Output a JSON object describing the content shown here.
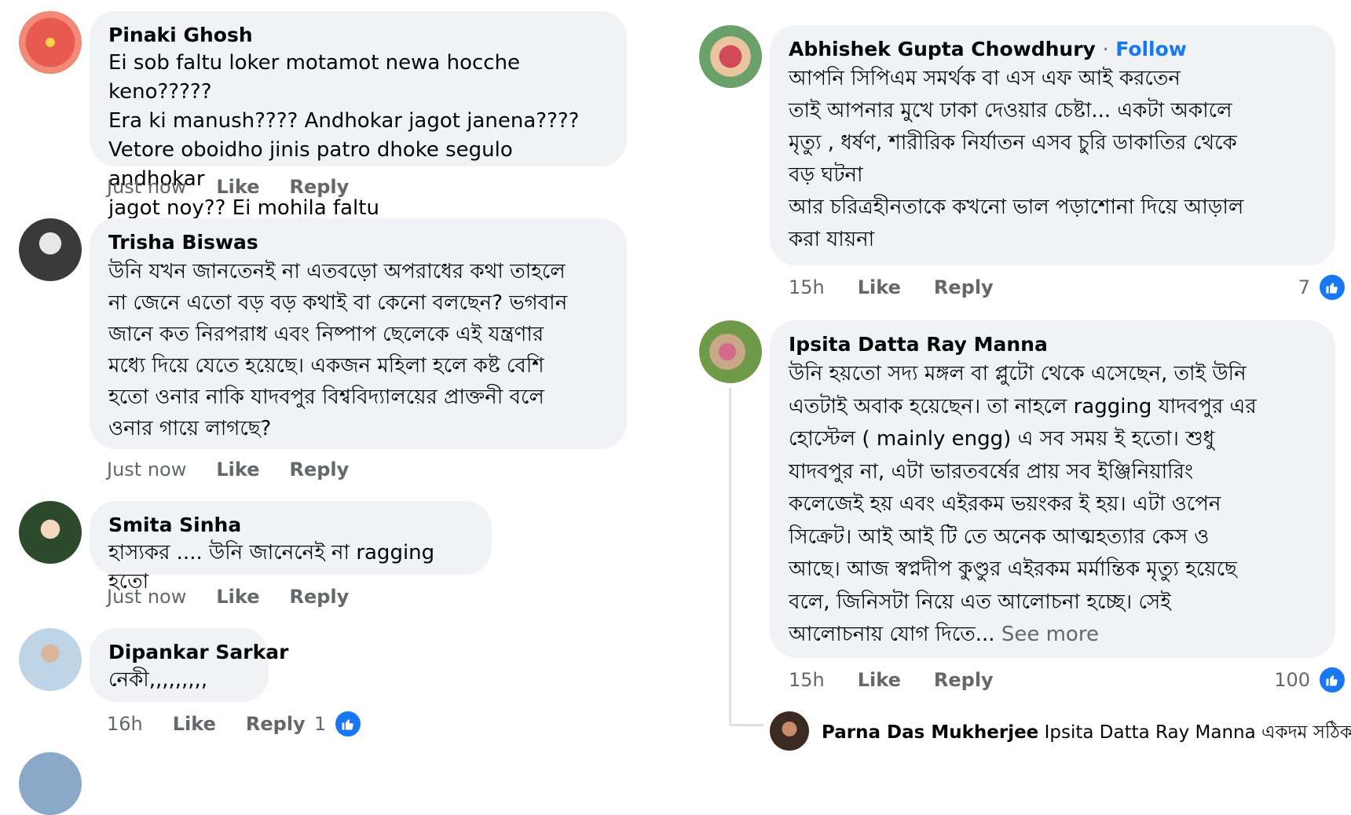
{
  "left_comments": [
    {
      "author": "Pinaki Ghosh",
      "lines": [
        "Ei sob faltu loker motamot newa hocche keno?????",
        "Era ki manush???? Andhokar jagot janena????",
        "Vetore oboidho jinis patro dhoke segulo andhokar",
        "jagot noy?? Ei mohila faltu"
      ],
      "time": "Just now",
      "like": "Like",
      "reply": "Reply"
    },
    {
      "author": "Trisha Biswas",
      "lines": [
        "উনি যখন জানতেনই না এতবড়ো অপরাধের কথা তাহলে",
        "না জেনে এতো বড় বড় কথাই বা কেনো বলছেন? ভগবান",
        "জানে কত নিরপরাধ এবং নিষ্পাপ ছেলেকে এই যন্ত্রণার",
        "মধ্যে দিয়ে যেতে হয়েছে। একজন মহিলা হলে কষ্ট বেশি",
        "হতো ওনার নাকি যাদবপুর বিশ্ববিদ্যালয়ের প্রাক্তনী বলে",
        "ওনার গায়ে লাগছে?"
      ],
      "time": "Just now",
      "like": "Like",
      "reply": "Reply"
    },
    {
      "author": "Smita Sinha",
      "lines": [
        "হাস্যকর .... উনি জানেনেই না ragging হতো"
      ],
      "time": "Just now",
      "like": "Like",
      "reply": "Reply"
    },
    {
      "author": "Dipankar Sarkar",
      "lines": [
        "নেকী,,,,,,,,,"
      ],
      "time": "16h",
      "like": "Like",
      "reply": "Reply",
      "reactions": "1"
    }
  ],
  "right_comments": [
    {
      "author": "Abhishek Gupta Chowdhury",
      "separator": "·",
      "follow": "Follow",
      "lines": [
        "আপনি সিপিএম সমর্থক বা এস এফ আই করতেন",
        "তাই আপনার মুখে ঢাকা দেওয়ার চেষ্টা... একটা অকালে",
        "মৃত্যু , ধর্ষণ, শারীরিক নির্যাতন এসব চুরি ডাকাতির থেকে",
        "বড় ঘটনা",
        "আর চরিত্রহীনতাকে কখনো ভাল পড়াশোনা দিয়ে আড়াল",
        "করা যায়না"
      ],
      "time": "15h",
      "like": "Like",
      "reply": "Reply",
      "reactions": "7"
    },
    {
      "author": "Ipsita Datta Ray Manna",
      "lines": [
        "উনি হয়তো সদ্য মঙ্গল বা প্লুটো থেকে এসেছেন, তাই উনি",
        "এতটাই অবাক হয়েছেন। তা নাহলে ragging যাদবপুর এর",
        "হোস্টেল ( mainly engg) এ সব সময় ই হতো। শুধু",
        "যাদবপুর না, এটা ভারতবর্ষের প্রায় সব ইঞ্জিনিয়ারিং",
        "কলেজেই হয়  এবং এইরকম ভয়ংকর ই হয়। এটা ওপেন",
        "সিক্রেট। আই আই টি তে  অনেক আত্মহত্যার কেস ও",
        "আছে। আজ স্বপ্নদীপ কুণ্ডুর এইরকম মর্মান্তিক মৃত্যু হয়েছে",
        "বলে, জিনিসটা নিয়ে এত আলোচনা হচ্ছে। সেই"
      ],
      "last_line": "আলোচনায় যোগ দিতে...",
      "see_more": "See more",
      "time": "15h",
      "like": "Like",
      "reply": "Reply",
      "reactions": "100"
    }
  ],
  "reply_preview": {
    "author": "Parna Das Mukherjee",
    "text": "Ipsita Datta Ray Manna একদম সঠিক ..."
  },
  "colors": {
    "bubble": "#f0f2f5",
    "meta": "#65676b",
    "accent": "#1877f2"
  }
}
